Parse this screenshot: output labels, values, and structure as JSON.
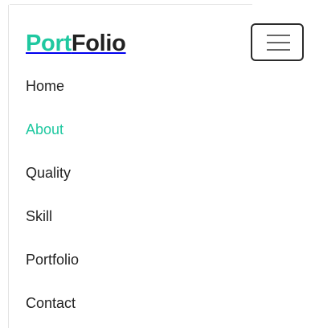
{
  "brand": {
    "part1": "Port",
    "part2": "Folio"
  },
  "toggler": {
    "icon": "hamburger-menu-icon",
    "aria_label": "Toggle navigation"
  },
  "nav": {
    "items": [
      {
        "label": "Home"
      },
      {
        "label": "About"
      },
      {
        "label": "Quality"
      },
      {
        "label": "Skill"
      },
      {
        "label": "Portfolio"
      },
      {
        "label": "Contact"
      }
    ],
    "active_index": 1
  },
  "colors": {
    "accent": "#1fc8a0",
    "text": "#222222",
    "toggler_border": "#2b2b2b",
    "toggler_bars": "#666666"
  }
}
